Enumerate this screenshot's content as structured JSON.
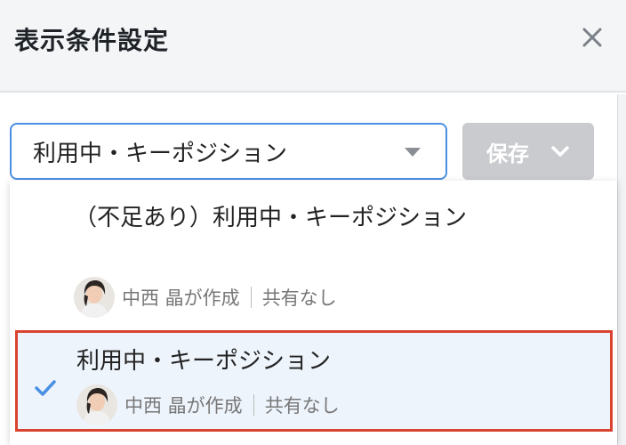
{
  "header": {
    "title": "表示条件設定",
    "close_icon": "close-icon"
  },
  "select": {
    "value": "利用中・キーポジション",
    "caret_icon": "caret-down-icon"
  },
  "save_button": {
    "label": "保存",
    "chevron_icon": "chevron-down-icon",
    "color": "#c9cbce"
  },
  "dropdown": {
    "items": [
      {
        "title": "（不足あり）利用中・キーポジション",
        "creator": "中西 晶が作成",
        "sharing": "共有なし",
        "selected": false
      },
      {
        "title": "利用中・キーポジション",
        "creator": "中西 晶が作成",
        "sharing": "共有なし",
        "selected": true
      }
    ]
  },
  "colors": {
    "accent": "#4a90e2",
    "highlight_border": "#d9432f",
    "selected_bg": "#eef4fc"
  }
}
